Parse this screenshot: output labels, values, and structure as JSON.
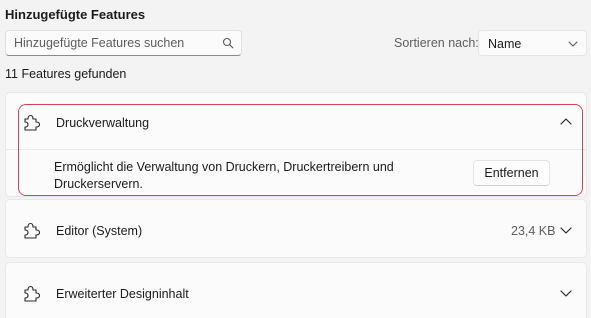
{
  "section": {
    "title": "Hinzugefügte Features"
  },
  "search": {
    "placeholder": "Hinzugefügte Features suchen",
    "icon": "search-icon"
  },
  "sort": {
    "label": "Sortieren nach:",
    "selected": "Name"
  },
  "result_count": "11 Features gefunden",
  "features": [
    {
      "name": "Druckverwaltung",
      "expanded": true,
      "description": "Ermöglicht die Verwaltung von Druckern, Druckertreibern und Druckerservern.",
      "remove_label": "Entfernen"
    },
    {
      "name": "Editor (System)",
      "size": "23,4 KB",
      "expanded": false
    },
    {
      "name": "Erweiterter Designinhalt",
      "expanded": false
    }
  ],
  "colors": {
    "highlight": "#d8454f",
    "card_bg": "#fbfbfb",
    "page_bg": "#f3f3f3"
  }
}
